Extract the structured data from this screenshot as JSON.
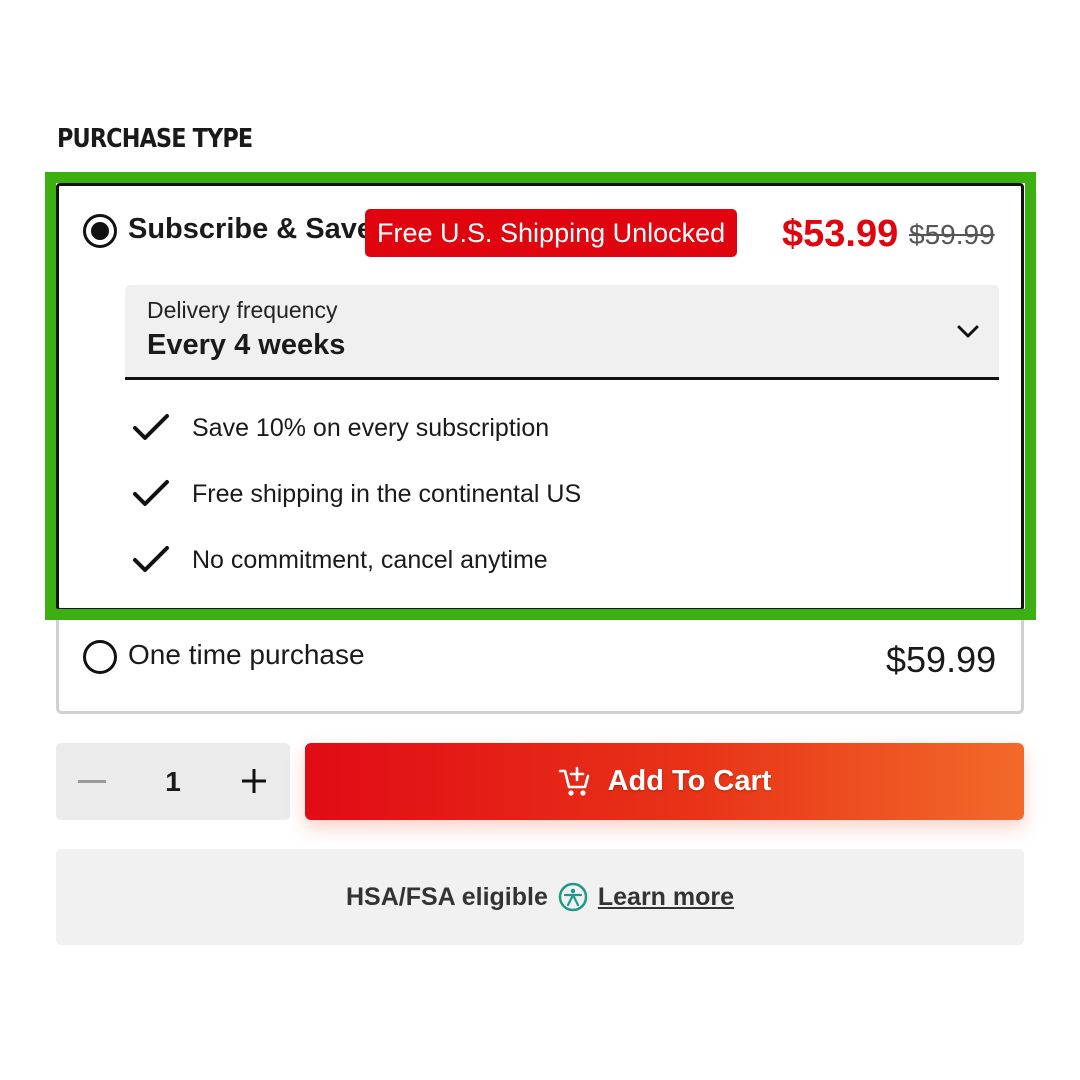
{
  "section": {
    "title": "PURCHASE TYPE"
  },
  "subscribe": {
    "label": "Subscribe & Save",
    "badge": "Free U.S. Shipping Unlocked",
    "price": "$53.99",
    "original_price": "$59.99",
    "selected": true,
    "frequency": {
      "label": "Delivery frequency",
      "value": "Every 4 weeks"
    },
    "benefits": [
      "Save 10% on every subscription",
      "Free shipping in the continental US",
      "No commitment, cancel anytime"
    ]
  },
  "one_time": {
    "label": "One time purchase",
    "price": "$59.99",
    "selected": false
  },
  "quantity": {
    "value": "1"
  },
  "cart": {
    "label": "Add To Cart"
  },
  "hsa": {
    "text": "HSA/FSA eligible",
    "link": "Learn more"
  },
  "colors": {
    "brand_red": "#e0040f",
    "cart_gradient_start": "#e10b15",
    "cart_gradient_end": "#f26a2a",
    "highlight_green": "#3cb010",
    "hsa_icon": "#1f9a8a"
  },
  "icons": {
    "frequency_dropdown": "chevron-down-icon",
    "benefit": "checkmark-icon",
    "cart": "cart-add-icon",
    "hsa": "hsa-accessibility-icon",
    "qty_minus": "minus-icon",
    "qty_plus": "plus-icon"
  }
}
